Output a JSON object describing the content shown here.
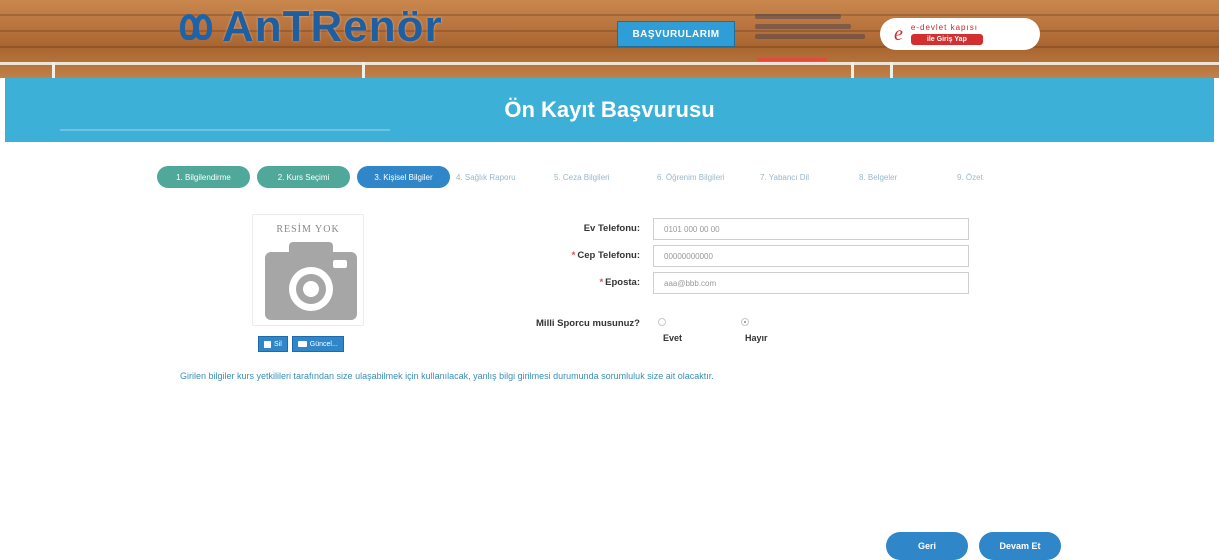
{
  "header": {
    "logo_text": "AnTRenör",
    "applications_button": "BAŞVURULARIM",
    "edevlet_top": "e-devlet kapısı",
    "edevlet_login": "ile Giriş Yap",
    "edevlet_mark": "e"
  },
  "page": {
    "title": "Ön Kayıt Başvurusu"
  },
  "steps": [
    {
      "label": "1. Bilgilendirme",
      "state": "done"
    },
    {
      "label": "2. Kurs Seçimi",
      "state": "done"
    },
    {
      "label": "3. Kişisel Bilgiler",
      "state": "active"
    },
    {
      "label": "4. Sağlık Raporu",
      "state": "pending"
    },
    {
      "label": "5. Ceza Bilgileri",
      "state": "pending"
    },
    {
      "label": "6. Öğrenim Bilgileri",
      "state": "pending"
    },
    {
      "label": "7. Yabancı Dil",
      "state": "pending"
    },
    {
      "label": "8. Belgeler",
      "state": "pending"
    },
    {
      "label": "9. Özet",
      "state": "pending"
    }
  ],
  "photo": {
    "placeholder": "RESİM YOK",
    "delete_label": "Sil",
    "update_label": "Güncel..."
  },
  "form": {
    "home_phone": {
      "label": "Ev Telefonu:",
      "value": "0101 000 00 00",
      "required": false
    },
    "mobile_phone": {
      "label": "Cep Telefonu:",
      "value": "00000000000",
      "required": true
    },
    "email": {
      "label": "Eposta:",
      "value": "aaa@bbb.com",
      "required": true
    },
    "national_athlete": {
      "label": "Milli Sporcu musunuz?",
      "options": [
        "Evet",
        "Hayır"
      ],
      "selected": "Hayır"
    },
    "required_mark": "*"
  },
  "info_text": "Girilen bilgiler kurs yetkilileri tarafından size ulaşabilmek için kullanılacak, yanlış bilgi girilmesi durumunda sorumluluk size ait olacaktır.",
  "navigation": {
    "back_label": "Geri",
    "next_label": "Devam Et"
  },
  "colors": {
    "title_band": "#3db0d8",
    "step_done": "#4fa89a",
    "step_active": "#2f86c9",
    "primary_button": "#2f86c9",
    "required_mark": "#e05050"
  }
}
